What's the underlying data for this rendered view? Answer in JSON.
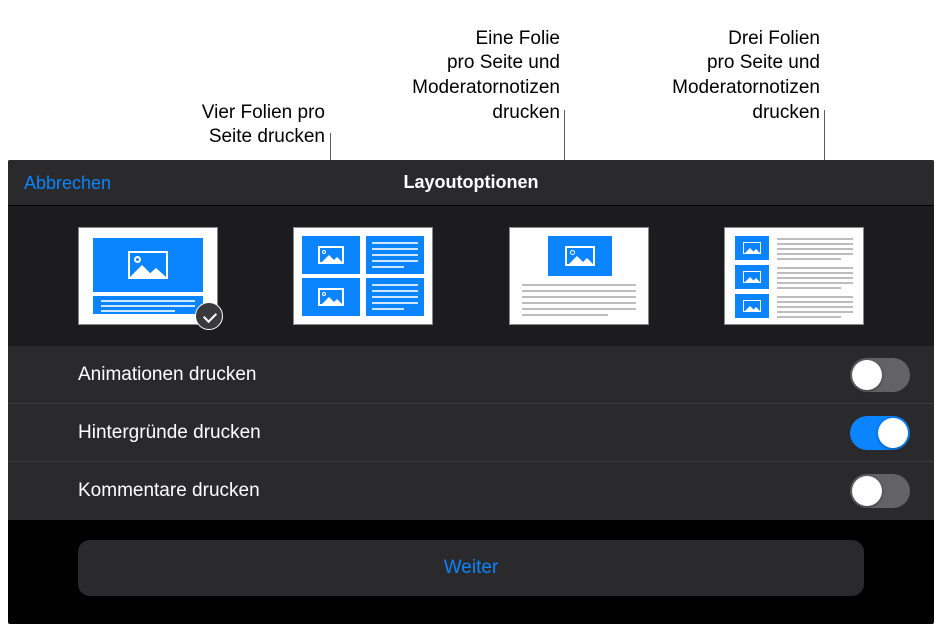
{
  "callouts": {
    "four_slides": "Vier Folien pro\nSeite drucken",
    "one_slide_notes": "Eine Folie\npro Seite und\nModeratornotizen\ndrucken",
    "three_slides_notes": "Drei Folien\npro Seite und\nModeratornotizen\ndrucken"
  },
  "header": {
    "cancel": "Abbrechen",
    "title": "Layoutoptionen"
  },
  "options": {
    "print_animations": {
      "label": "Animationen drucken",
      "value": false
    },
    "print_backgrounds": {
      "label": "Hintergründe drucken",
      "value": true
    },
    "print_comments": {
      "label": "Kommentare drucken",
      "value": false
    }
  },
  "continue_label": "Weiter",
  "colors": {
    "accent": "#0a84ff"
  }
}
